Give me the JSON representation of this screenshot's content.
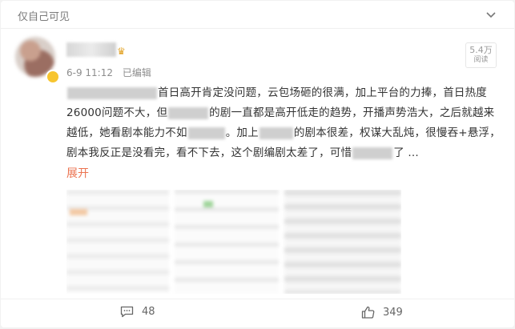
{
  "header": {
    "visibility": "仅自己可见",
    "collapse_icon": "chevron-down-icon"
  },
  "author": {
    "avatar_icon": "avatar",
    "badge_icon": "crown-icon",
    "verified_color": "#f7c530"
  },
  "meta": {
    "date": "6-9 11:12",
    "edited": "已编辑"
  },
  "reads": {
    "count": "5.4万",
    "label": "阅读"
  },
  "post": {
    "seg1": "首日高开肯定没问题，云包场砸的很满，加上平台的力捧，首日热度26000问题不大，但",
    "seg2": "的剧一直都是高开低走的趋势，开播声势浩大，之后就越来越低，她看剧本能力不如",
    "seg3": "。加上",
    "seg4": "的剧本很差，权谋大乱炖，很慢吞+悬浮，剧本我反正是没看完，看不下去，这个剧编剧太差了，可惜",
    "seg5": "了 ...",
    "expand": "展开"
  },
  "footer": {
    "comments": "48",
    "likes": "349",
    "comment_icon": "comment-icon",
    "like_icon": "thumbs-up-icon"
  },
  "colors": {
    "accent": "#eb7350",
    "text": "#333333",
    "muted": "#8d8d8d"
  }
}
